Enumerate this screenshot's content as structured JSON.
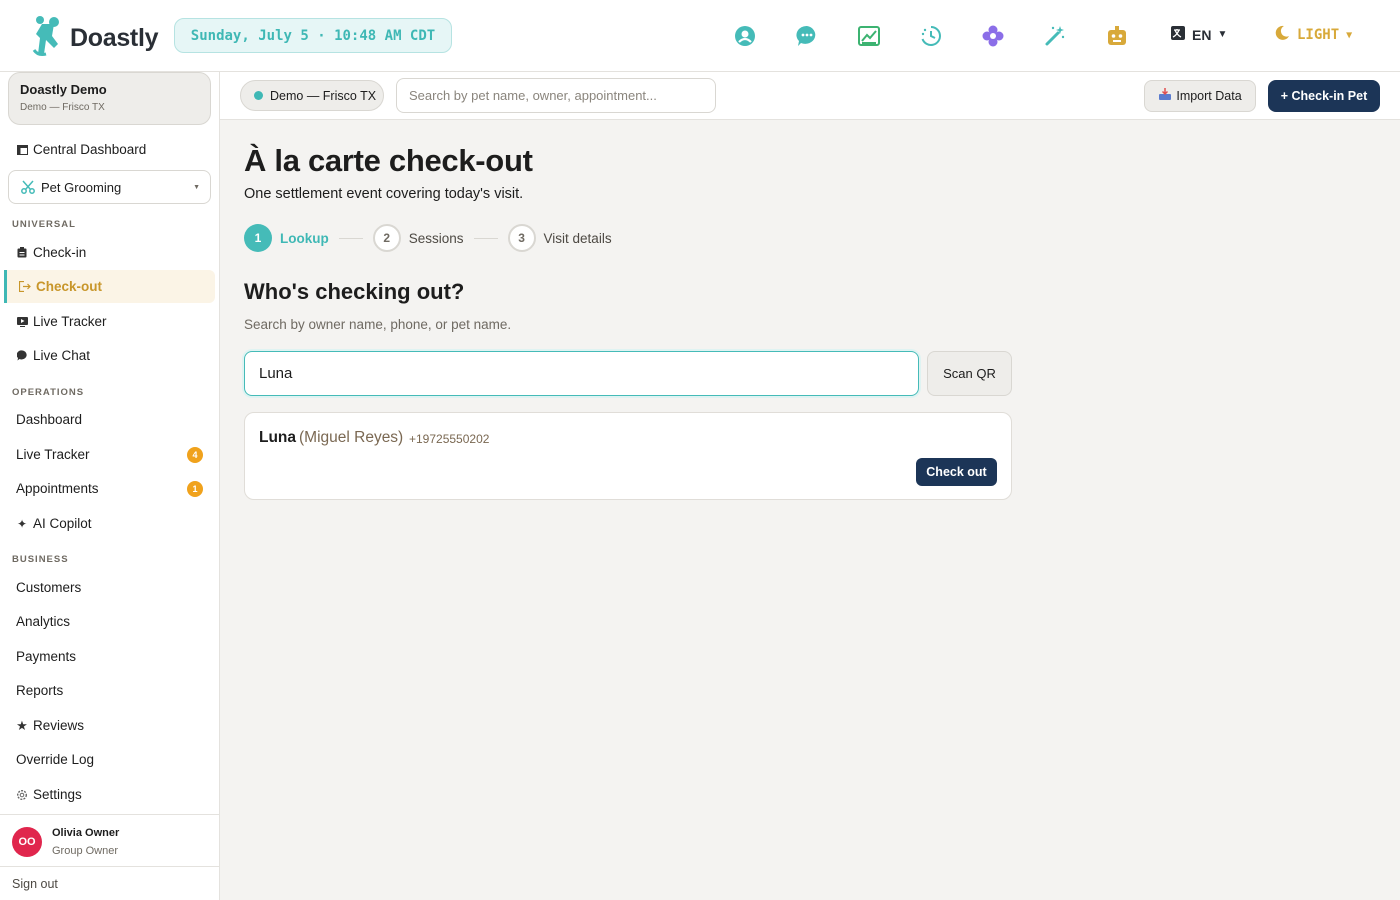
{
  "app": {
    "brand": "Doastly",
    "datetime": "Sunday, July 5 · 10:48 AM CDT",
    "language": "EN",
    "theme": "LIGHT",
    "accent_color": "#3fb8b5",
    "navy_color": "#1c3557"
  },
  "top_icons": [
    "support-icon",
    "chat-icon",
    "chart-icon",
    "history-clock-icon",
    "flower-icon",
    "magic-wand-icon",
    "robot-icon"
  ],
  "sidebar": {
    "org_name": "Doastly Demo",
    "org_location": "Demo — Frisco TX",
    "central_dashboard": "Central Dashboard",
    "service_selector": "Pet Grooming",
    "sections": {
      "universal": "UNIVERSAL",
      "operations": "OPERATIONS",
      "business": "BUSINESS"
    },
    "universal_items": [
      {
        "label": "Check-in"
      },
      {
        "label": "Check-out",
        "active": true
      },
      {
        "label": "Live Tracker"
      },
      {
        "label": "Live Chat"
      }
    ],
    "operations_items": [
      {
        "label": "Dashboard"
      },
      {
        "label": "Live Tracker",
        "badge": "4"
      },
      {
        "label": "Appointments",
        "badge": "1"
      },
      {
        "label": "AI Copilot"
      }
    ],
    "business_items": [
      {
        "label": "Customers"
      },
      {
        "label": "Analytics"
      },
      {
        "label": "Payments"
      },
      {
        "label": "Reports"
      },
      {
        "label": "Reviews"
      },
      {
        "label": "Override Log"
      },
      {
        "label": "Settings"
      }
    ],
    "user": {
      "initials": "OO",
      "name": "Olivia Owner",
      "role": "Group Owner"
    },
    "sign_out": "Sign out"
  },
  "subheader": {
    "location": "Demo — Frisco TX",
    "search_placeholder": "Search by pet name, owner, appointment...",
    "import_label": "Import Data",
    "checkin_label": "+ Check-in Pet"
  },
  "page": {
    "title": "À la carte check-out",
    "subtitle": "One settlement event covering today's visit.",
    "steps": [
      {
        "num": "1",
        "label": "Lookup",
        "active": true
      },
      {
        "num": "2",
        "label": "Sessions",
        "active": false
      },
      {
        "num": "3",
        "label": "Visit details",
        "active": false
      }
    ],
    "section_title": "Who's checking out?",
    "section_hint": "Search by owner name, phone, or pet name.",
    "lookup_value": "Luna",
    "scan_label": "Scan QR",
    "result": {
      "pet": "Luna",
      "owner": "(Miguel Reyes)",
      "phone": "+19725550202",
      "action": "Check out"
    }
  }
}
